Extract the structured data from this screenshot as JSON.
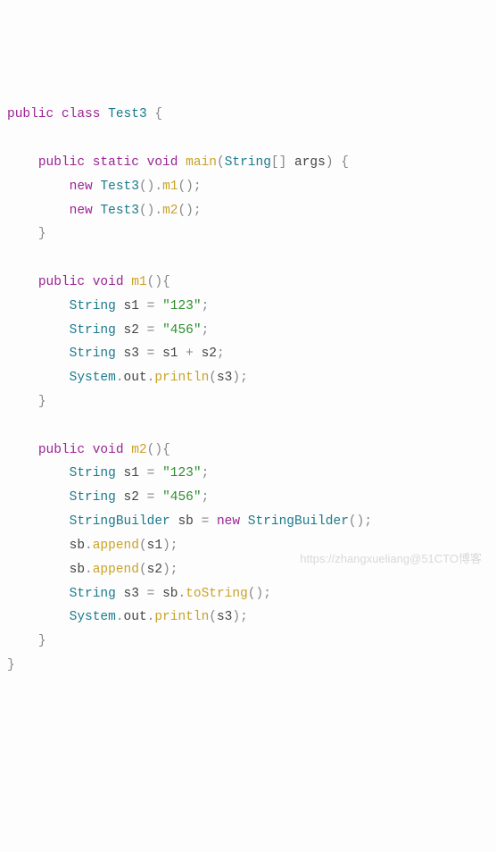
{
  "kw": {
    "public": "public",
    "class": "class",
    "static": "static",
    "void": "void",
    "new": "new"
  },
  "cls": {
    "Test3": "Test3",
    "String": "String",
    "System": "System",
    "StringBuilder": "StringBuilder"
  },
  "mtd": {
    "main": "main",
    "m1": "m1",
    "m2": "m2",
    "println": "println",
    "append": "append",
    "toString": "toString"
  },
  "id": {
    "args": "args",
    "s1": "s1",
    "s2": "s2",
    "s3": "s3",
    "sb": "sb",
    "out": "out"
  },
  "str": {
    "v123": "\"123\"",
    "v456": "\"456\""
  },
  "p": {
    "ob": "{",
    "cb": "}",
    "op": "(",
    "cp": ")",
    "osb": "[",
    "csb": "]",
    "semi": ";",
    "dot": ".",
    "eq": "=",
    "plus": "+"
  },
  "watermark": "https://zhangxueliang@51CTO博客"
}
